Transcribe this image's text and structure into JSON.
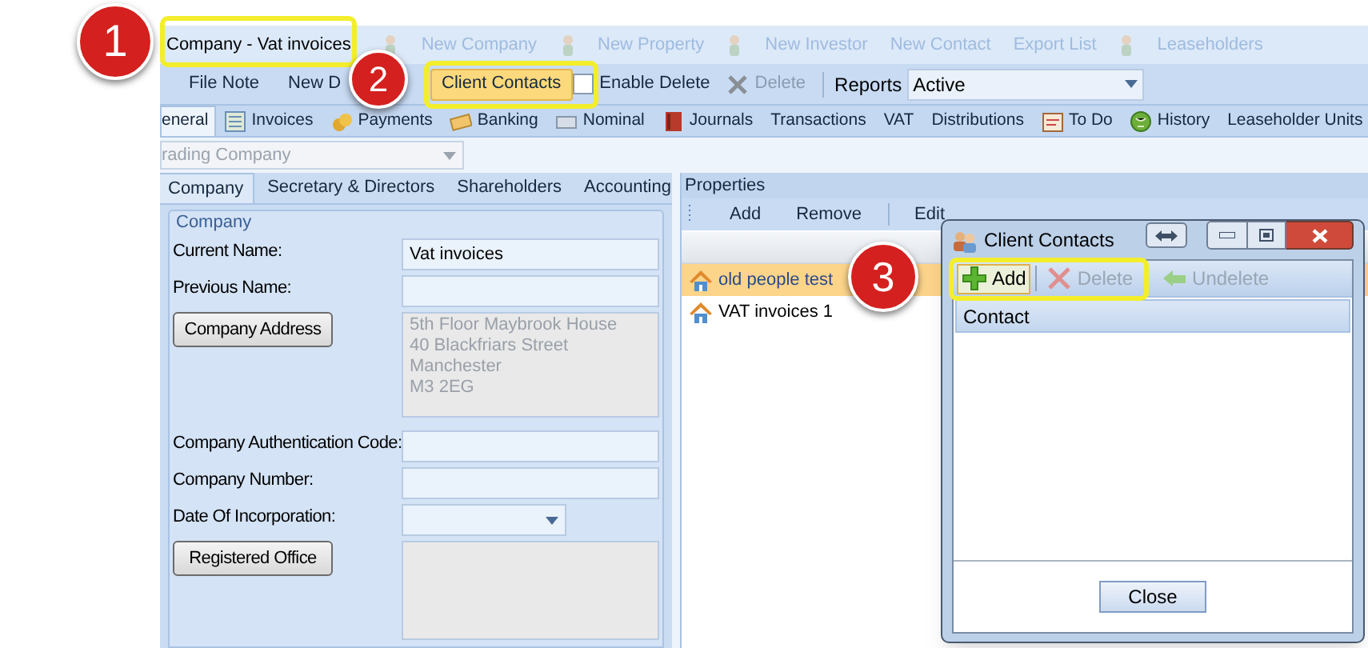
{
  "window": {
    "title": "Company - Vat invoices"
  },
  "quick_toolbar": [
    "New Company",
    "New Property",
    "New Investor",
    "New Contact",
    "Export List",
    "Leaseholders"
  ],
  "ribbon": [
    {
      "kind": "button",
      "label": "File Note",
      "highlighted": false,
      "disabled": false
    },
    {
      "kind": "button",
      "label": "New D",
      "highlighted": false,
      "disabled": false
    },
    {
      "kind": "button",
      "label": "Client Contacts",
      "highlighted": true,
      "disabled": false
    },
    {
      "kind": "checkbox",
      "label": "Enable Delete",
      "checked": false
    },
    {
      "kind": "button",
      "label": "Delete",
      "highlighted": false,
      "disabled": true
    },
    {
      "kind": "label",
      "label": "Reports"
    },
    {
      "kind": "select",
      "value": "Active"
    }
  ],
  "tabs": [
    {
      "label": "eneral",
      "selected": true
    },
    {
      "label": "Invoices",
      "selected": false
    },
    {
      "label": "Payments",
      "selected": false
    },
    {
      "label": "Banking",
      "selected": false
    },
    {
      "label": "Nominal",
      "selected": false
    },
    {
      "label": "Journals",
      "selected": false
    },
    {
      "label": "Transactions",
      "selected": false
    },
    {
      "label": "VAT",
      "selected": false
    },
    {
      "label": "Distributions",
      "selected": false
    },
    {
      "label": "To Do",
      "selected": false
    },
    {
      "label": "History",
      "selected": false
    },
    {
      "label": "Leaseholder Units",
      "selected": false
    }
  ],
  "company_combo": {
    "value": "rading Company",
    "disabled": true
  },
  "sub_tabs": [
    {
      "label": "Company",
      "selected": true
    },
    {
      "label": "Secretary & Directors",
      "selected": false
    },
    {
      "label": "Shareholders",
      "selected": false
    },
    {
      "label": "Accounting",
      "selected": false
    }
  ],
  "company_group": {
    "title": "Company",
    "fields": [
      {
        "kind": "text",
        "label": "Current Name:",
        "value": "Vat invoices"
      },
      {
        "kind": "text",
        "label": "Previous Name:"
      },
      {
        "kind": "address",
        "label": "Company Address",
        "lines": [
          "5th Floor Maybrook House",
          "40 Blackfriars Street",
          "Manchester",
          "M3 2EG"
        ]
      },
      {
        "kind": "text",
        "label": "Company Authentication Code:"
      },
      {
        "kind": "text",
        "label": "Company Number:"
      },
      {
        "kind": "date",
        "label": "Date Of Incorporation:"
      },
      {
        "kind": "address",
        "label": "Registered Office"
      }
    ]
  },
  "properties": {
    "title": "Properties",
    "toolbar": [
      "Add",
      "Remove",
      "Edit"
    ],
    "rows": [
      {
        "name": "old people test",
        "selected": true
      },
      {
        "name": "VAT invoices 1",
        "selected": false
      }
    ]
  },
  "dialog": {
    "title": "Client Contacts",
    "toolbar": [
      {
        "label": "Add",
        "disabled": false,
        "highlighted": true
      },
      {
        "label": "Delete",
        "disabled": true,
        "highlighted": false
      },
      {
        "label": "Undelete",
        "disabled": true,
        "highlighted": false
      }
    ],
    "columns": [
      "Contact"
    ],
    "close_button": "Close"
  },
  "callouts": [
    "1",
    "2",
    "3"
  ]
}
